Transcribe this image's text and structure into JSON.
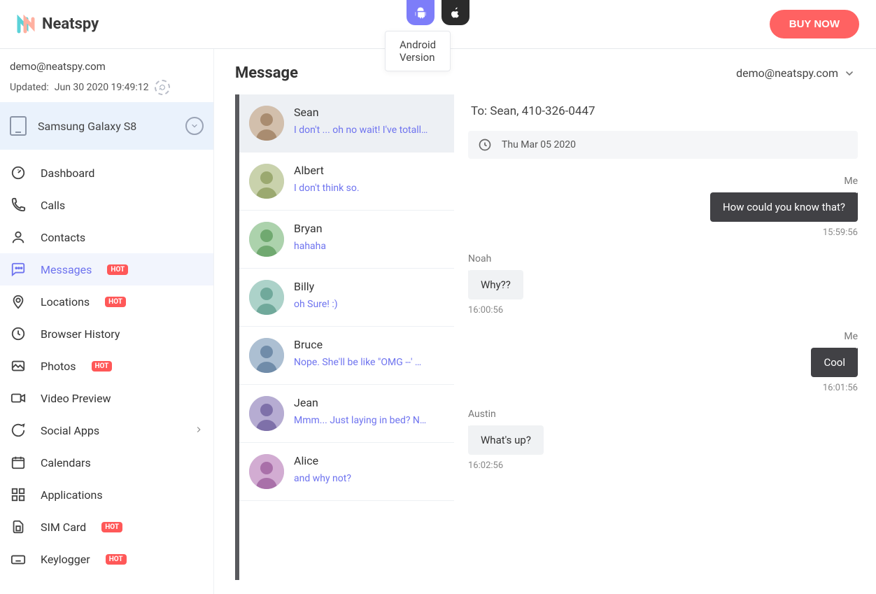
{
  "header": {
    "brand": "Neatspy",
    "android_tooltip": "Android Version",
    "buy_label": "BUY NOW"
  },
  "account": {
    "email": "demo@neatspy.com",
    "updated_prefix": "Updated: ",
    "updated_time": "Jun 30 2020 19:49:12"
  },
  "device": {
    "name": "Samsung Galaxy S8"
  },
  "menu": [
    {
      "label": "Dashboard",
      "hot": false
    },
    {
      "label": "Calls",
      "hot": false
    },
    {
      "label": "Contacts",
      "hot": false
    },
    {
      "label": "Messages",
      "hot": true,
      "active": true
    },
    {
      "label": "Locations",
      "hot": true
    },
    {
      "label": "Browser History",
      "hot": false
    },
    {
      "label": "Photos",
      "hot": true
    },
    {
      "label": "Video Preview",
      "hot": false
    },
    {
      "label": "Social Apps",
      "hot": false,
      "has_children": true
    },
    {
      "label": "Calendars",
      "hot": false
    },
    {
      "label": "Applications",
      "hot": false
    },
    {
      "label": "SIM Card",
      "hot": true
    },
    {
      "label": "Keylogger",
      "hot": true
    }
  ],
  "hot_label": "HOT",
  "page": {
    "title": "Message",
    "user_email": "demo@neatspy.com"
  },
  "conversations": [
    {
      "name": "Sean",
      "preview": "I don't ... oh no wait! I've totall…",
      "selected": true
    },
    {
      "name": "Albert",
      "preview": "I don't think so."
    },
    {
      "name": "Bryan",
      "preview": "hahaha"
    },
    {
      "name": "Billy",
      "preview": "oh Sure! :)"
    },
    {
      "name": "Bruce",
      "preview": "Nope. She'll be like \"OMG --' …"
    },
    {
      "name": "Jean",
      "preview": "Mmm... Just laying in bed? N…"
    },
    {
      "name": "Alice",
      "preview": "and why not?"
    }
  ],
  "thread": {
    "to_label": "To: Sean, 410-326-0447",
    "date": "Thu Mar 05 2020",
    "messages": [
      {
        "from": "Me",
        "text": "How could you know that?",
        "time": "15:59:56",
        "dir": "out"
      },
      {
        "from": "Noah",
        "text": "Why??",
        "time": "16:00:56",
        "dir": "in"
      },
      {
        "from": "Me",
        "text": "Cool",
        "time": "16:01:56",
        "dir": "out"
      },
      {
        "from": "Austin",
        "text": "What's up?",
        "time": "16:02:56",
        "dir": "in"
      }
    ]
  }
}
